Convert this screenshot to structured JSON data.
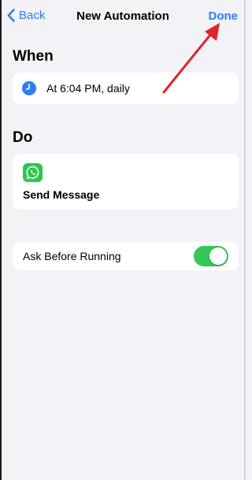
{
  "nav": {
    "back_label": "Back",
    "title": "New Automation",
    "done_label": "Done"
  },
  "when": {
    "header": "When",
    "trigger_label": "At 6:04 PM, daily",
    "icon": "clock-icon"
  },
  "do": {
    "header": "Do",
    "action_label": "Send Message",
    "icon": "whatsapp-icon"
  },
  "ask_before_running": {
    "label": "Ask Before Running",
    "enabled": true
  },
  "colors": {
    "accent": "#2f7cf6",
    "toggle_on": "#34c759",
    "annotation_arrow": "#e0242c",
    "background": "#f2f2f7"
  }
}
